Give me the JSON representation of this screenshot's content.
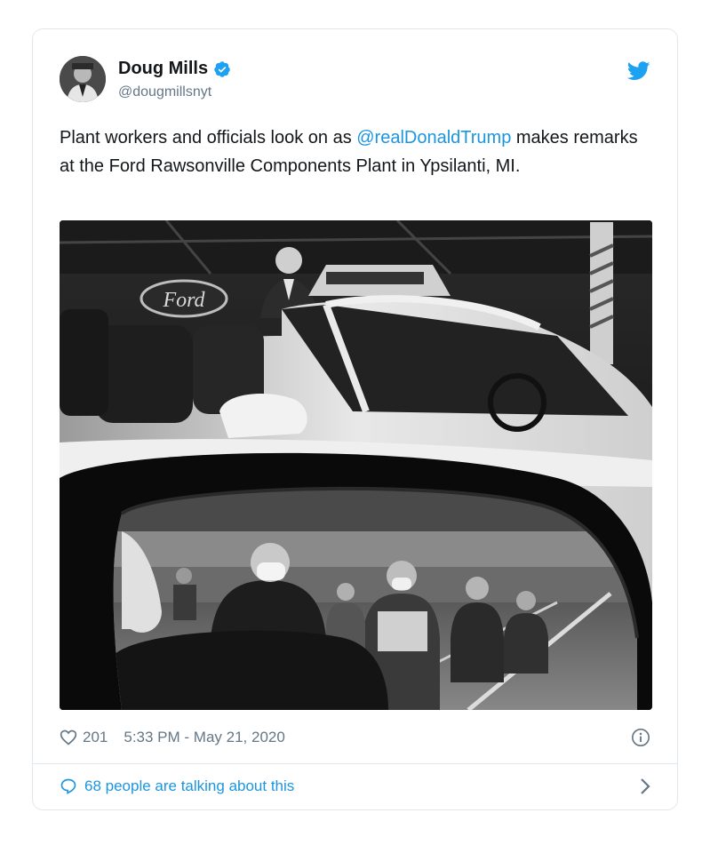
{
  "tweet": {
    "author": {
      "display_name": "Doug Mills",
      "handle": "@dougmillsnyt",
      "verified": true
    },
    "text_before": "Plant workers and officials look on as ",
    "mention": "@realDonaldTrump",
    "text_after": " makes remarks at the Ford Rawsonville Components Plant in Ypsilanti, MI.",
    "likes": "201",
    "timestamp": "5:33 PM - May 21, 2020",
    "talking": "68 people are talking about this"
  },
  "photo": {
    "logo_text": "Ford"
  },
  "colors": {
    "accent": "#1b95e0",
    "muted": "#657786",
    "border": "#e1e8ed",
    "text": "#14171a"
  },
  "icons": [
    "verified-badge-icon",
    "twitter-bird-icon",
    "heart-icon",
    "info-icon",
    "speech-bubble-icon",
    "chevron-right-icon"
  ]
}
